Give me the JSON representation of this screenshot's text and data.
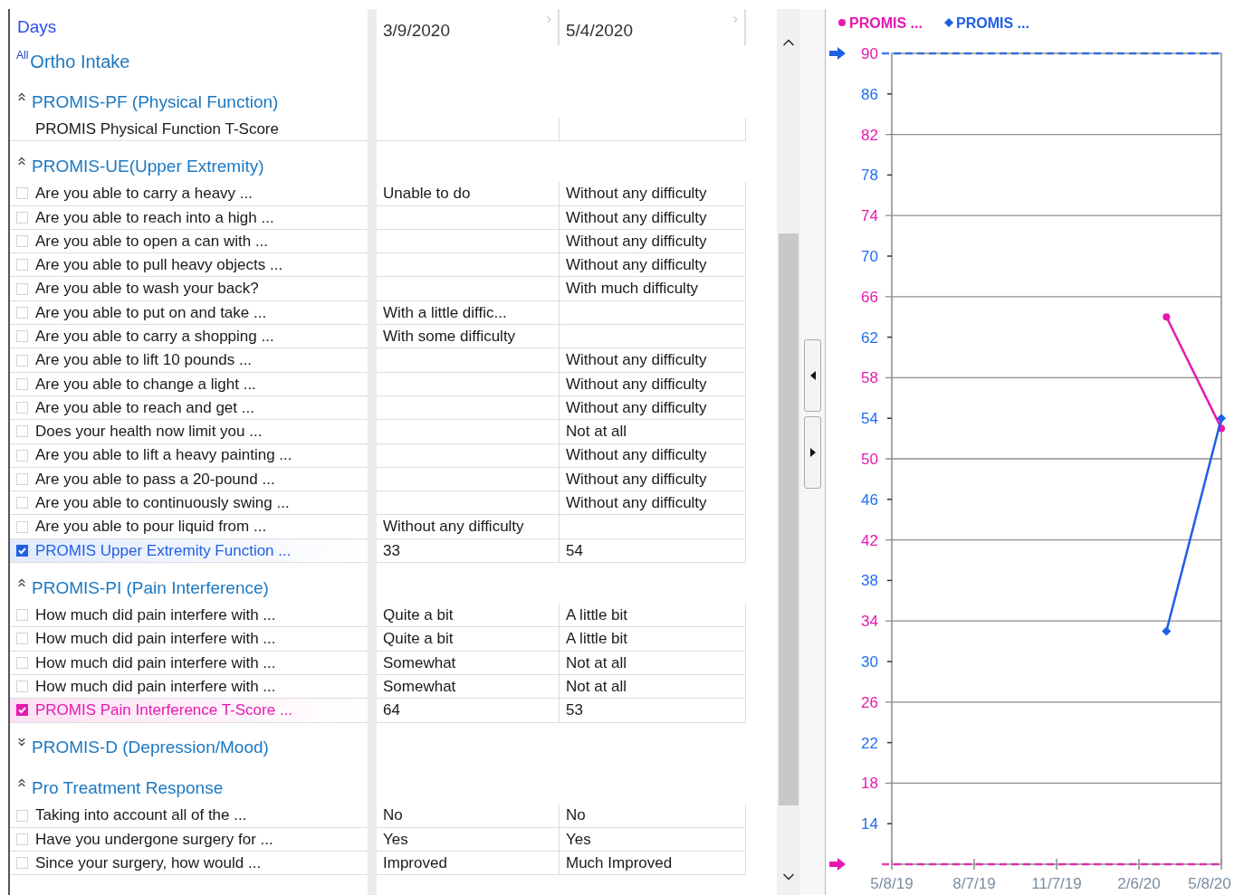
{
  "header": {
    "title": "Days",
    "columns": [
      {
        "label": "3/9/2020"
      },
      {
        "label": "5/4/2020"
      }
    ]
  },
  "group": {
    "prefix": "All",
    "title": "Ortho Intake"
  },
  "sections": [
    {
      "title": "PROMIS-PF (Physical Function)",
      "expanded": true,
      "rows": [
        {
          "kind": "plain",
          "label": "PROMIS Physical Function T-Score"
        }
      ]
    },
    {
      "title": "PROMIS-UE(Upper Extremity)",
      "expanded": true,
      "rows": [
        {
          "kind": "check",
          "checked": false,
          "label": "Are you able to carry a heavy ...",
          "value_1": "Unable to do",
          "value_2": "Without any difficulty"
        },
        {
          "kind": "check",
          "checked": false,
          "label": "Are you able to reach into a high ...",
          "value_2": "Without any difficulty"
        },
        {
          "kind": "check",
          "checked": false,
          "label": "Are you able to open a can with ...",
          "value_2": "Without any difficulty"
        },
        {
          "kind": "check",
          "checked": false,
          "label": "Are you able to pull heavy objects ...",
          "value_2": "Without any difficulty"
        },
        {
          "kind": "check",
          "checked": false,
          "label": "Are you able to wash your back?",
          "value_2": "With much difficulty"
        },
        {
          "kind": "check",
          "checked": false,
          "label": "Are you able to put on and take ...",
          "value_1": "With a little diffic..."
        },
        {
          "kind": "check",
          "checked": false,
          "label": "Are you able to carry a shopping ...",
          "value_1": "With some difficulty"
        },
        {
          "kind": "check",
          "checked": false,
          "label": "Are you able to lift 10 pounds ...",
          "value_2": "Without any difficulty"
        },
        {
          "kind": "check",
          "checked": false,
          "label": "Are you able to change a light ...",
          "value_2": "Without any difficulty"
        },
        {
          "kind": "check",
          "checked": false,
          "label": "Are you able to reach and get ...",
          "value_2": "Without any difficulty"
        },
        {
          "kind": "check",
          "checked": false,
          "label": "Does your health now limit you ...",
          "value_2": "Not at all"
        },
        {
          "kind": "check",
          "checked": false,
          "label": "Are you able to lift a heavy painting ...",
          "value_2": "Without any difficulty"
        },
        {
          "kind": "check",
          "checked": false,
          "label": "Are you able to pass a 20-pound ...",
          "value_2": "Without any difficulty"
        },
        {
          "kind": "check",
          "checked": false,
          "label": "Are you able to continuously swing ...",
          "value_2": "Without any difficulty"
        },
        {
          "kind": "check",
          "checked": false,
          "label": "Are you able to pour liquid from ...",
          "value_1": "Without any difficulty"
        },
        {
          "kind": "check",
          "checked": true,
          "color": "#1f5fe6",
          "label": "PROMIS Upper Extremity Function ...",
          "value_1": "33",
          "value_2": "54"
        }
      ]
    },
    {
      "title": "PROMIS-PI (Pain Interference)",
      "expanded": true,
      "rows": [
        {
          "kind": "check",
          "checked": false,
          "label": "How much did pain interfere with ...",
          "value_1": "Quite a bit",
          "value_2": "A little bit"
        },
        {
          "kind": "check",
          "checked": false,
          "label": "How much did pain interfere with ...",
          "value_1": "Quite a bit",
          "value_2": "A little bit"
        },
        {
          "kind": "check",
          "checked": false,
          "label": "How much did pain interfere with ...",
          "value_1": "Somewhat",
          "value_2": "Not at all"
        },
        {
          "kind": "check",
          "checked": false,
          "label": "How much did pain interfere with ...",
          "value_1": "Somewhat",
          "value_2": "Not at all"
        },
        {
          "kind": "check",
          "checked": true,
          "color": "#e619b0",
          "label": "PROMIS Pain Interference T-Score ...",
          "value_1": "64",
          "value_2": "53"
        }
      ]
    },
    {
      "title": "PROMIS-D (Depression/Mood)",
      "expanded": false
    },
    {
      "title": "Pro Treatment Response",
      "expanded": true,
      "rows": [
        {
          "kind": "check",
          "checked": false,
          "label": "Taking into account all of the ...",
          "value_1": "No",
          "value_2": "No"
        },
        {
          "kind": "check",
          "checked": false,
          "label": "Have you undergone surgery for ...",
          "value_1": "Yes",
          "value_2": "Yes"
        },
        {
          "kind": "check",
          "checked": false,
          "label": "Since your surgery, how would ...",
          "value_1": "Improved",
          "value_2": "Much Improved"
        }
      ]
    }
  ],
  "chart_data": {
    "type": "line",
    "categories": [
      "5/8/19",
      null,
      null,
      "8/7/19",
      null,
      null,
      "11/7/19",
      null,
      null,
      "2/6/20",
      null,
      null,
      "5/8/20"
    ],
    "series": [
      {
        "name": "PROMIS ...",
        "color": "#e619b0",
        "marker": "circle",
        "values": [
          null,
          null,
          null,
          null,
          null,
          null,
          null,
          null,
          null,
          null,
          64,
          null,
          53
        ]
      },
      {
        "name": "PROMIS ...",
        "color": "#1f5fe6",
        "marker": "diamond",
        "values": [
          null,
          null,
          null,
          null,
          null,
          null,
          null,
          null,
          null,
          null,
          33,
          null,
          54
        ]
      }
    ],
    "ylim": [
      10,
      90
    ],
    "grid": true,
    "yticks": [
      14,
      18,
      22,
      26,
      30,
      34,
      38,
      42,
      46,
      50,
      54,
      58,
      62,
      66,
      70,
      74,
      78,
      82,
      86,
      90
    ]
  }
}
